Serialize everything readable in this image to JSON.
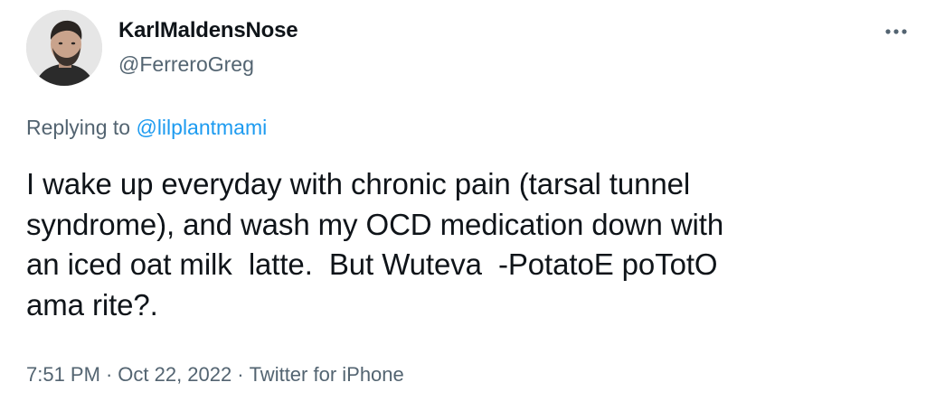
{
  "author": {
    "display_name": "KarlMaldensNose",
    "handle": "@FerreroGreg",
    "avatar_icon": "profile-photo-man-with-beard"
  },
  "header": {
    "more_icon": "more-options-icon"
  },
  "reply": {
    "prefix": "Replying to ",
    "mention": "@lilplantmami",
    "mention_color": "#1d9bf0"
  },
  "tweet": {
    "lines": [
      "I wake up everyday with chronic pain (tarsal tunnel",
      "syndrome), and wash my OCD medication down with",
      "an iced oat milk  latte.  But Wuteva  -PotatoE poTotO",
      "ama rite?."
    ]
  },
  "meta": {
    "time": "7:51 PM",
    "separator": "·",
    "date": "Oct 22, 2022",
    "source": "Twitter for iPhone"
  },
  "colors": {
    "text_primary": "#0f1419",
    "text_secondary": "#536471",
    "background": "#ffffff"
  }
}
